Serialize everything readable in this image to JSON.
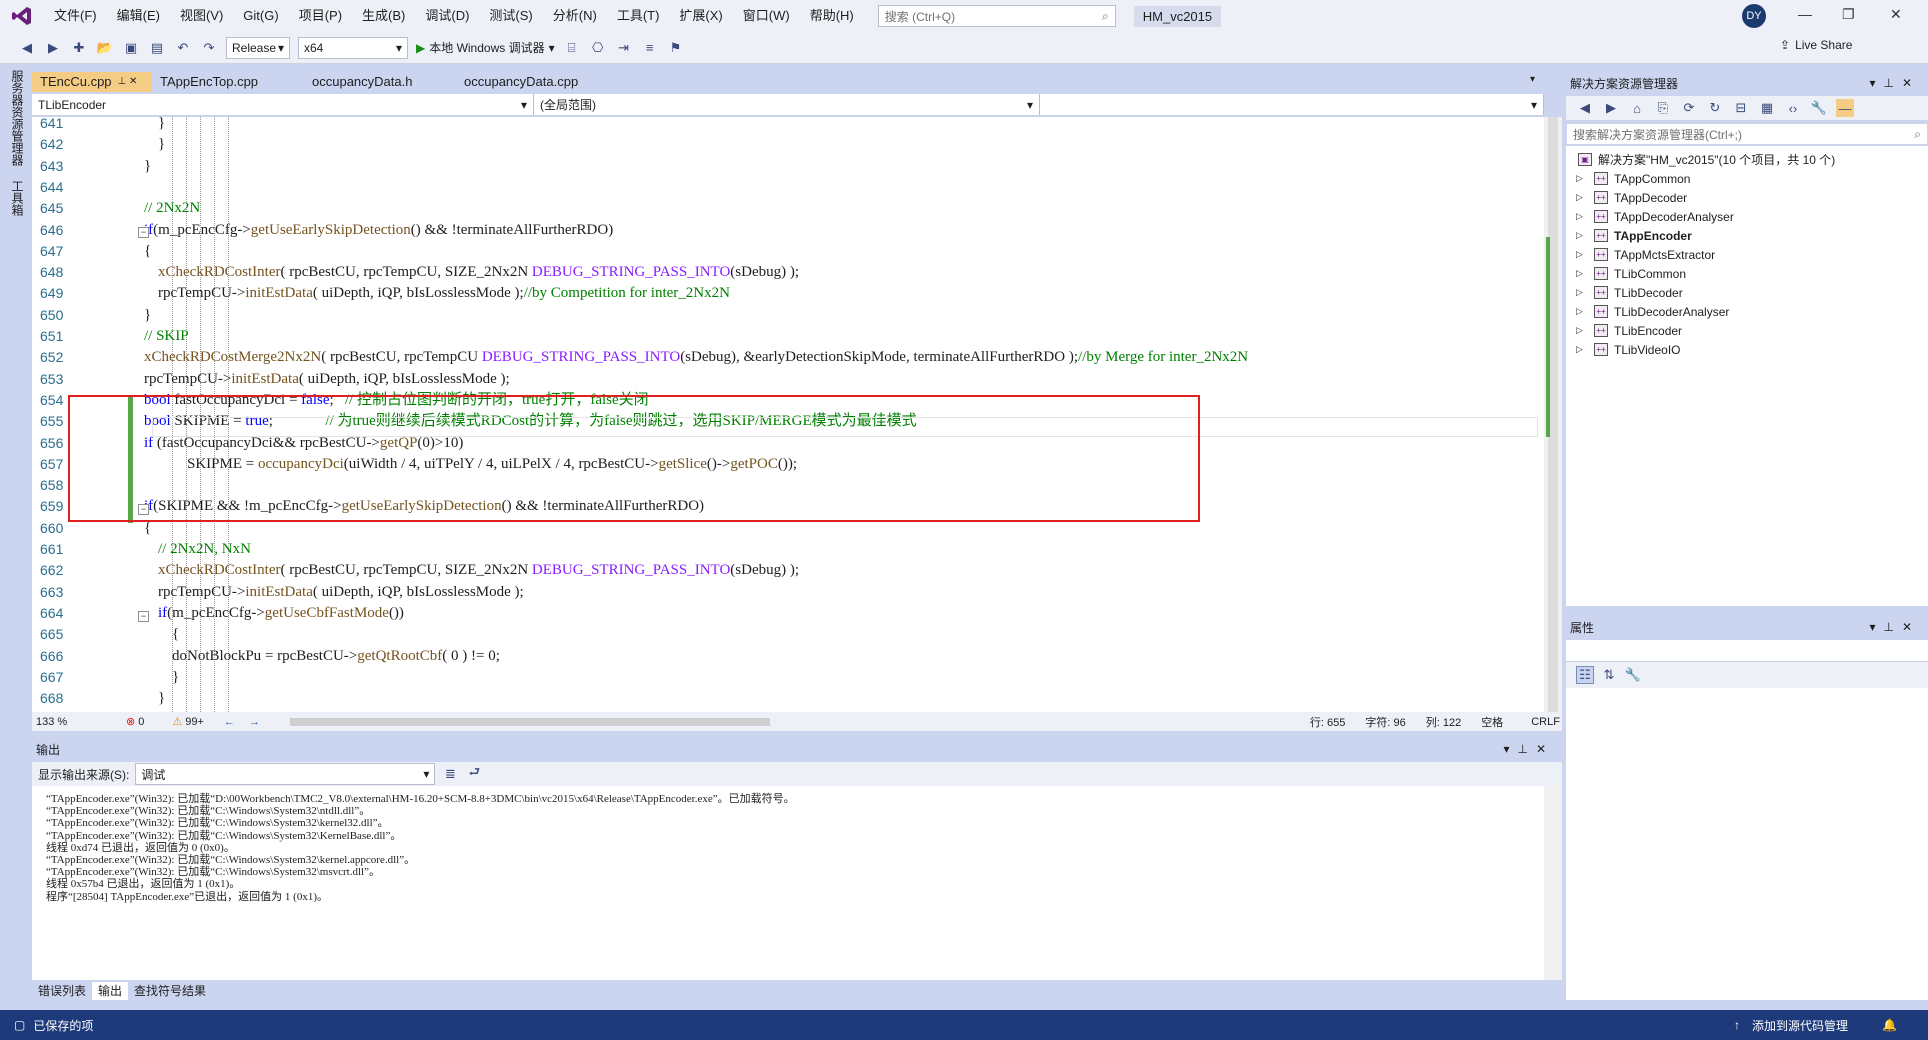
{
  "app": {
    "menu": [
      "文件(F)",
      "编辑(E)",
      "视图(V)",
      "Git(G)",
      "项目(P)",
      "生成(B)",
      "调试(D)",
      "测试(S)",
      "分析(N)",
      "工具(T)",
      "扩展(X)",
      "窗口(W)",
      "帮助(H)"
    ],
    "search_placeholder": "搜索 (Ctrl+Q)",
    "solution_name": "HM_vc2015",
    "user_initials": "DY",
    "live_share": "Live Share"
  },
  "toolbar": {
    "config": "Release",
    "platform": "x64",
    "run_label": "本地 Windows 调试器"
  },
  "left_strip": {
    "tab1": "服务器资源管理器",
    "tab2": "工具箱"
  },
  "editor": {
    "tabs": [
      {
        "label": "TEncCu.cpp",
        "active": true
      },
      {
        "label": "TAppEncTop.cpp",
        "active": false
      },
      {
        "label": "occupancyData.h",
        "active": false
      },
      {
        "label": "occupancyData.cpp",
        "active": false
      }
    ],
    "nav_scope": "TLibEncoder",
    "nav_member": "(全局范围)",
    "lines": [
      {
        "n": "641",
        "code": "}"
      },
      {
        "n": "642",
        "code": "}"
      },
      {
        "n": "643",
        "code": "}"
      },
      {
        "n": "644",
        "code": ""
      },
      {
        "n": "645",
        "code": "// 2Nx2N"
      },
      {
        "n": "646",
        "code": "if(m_pcEncCfg->getUseEarlySkipDetection() && !terminateAllFurtherRDO)"
      },
      {
        "n": "647",
        "code": "{"
      },
      {
        "n": "648",
        "code": "xCheckRDCostInter( rpcBestCU, rpcTempCU, SIZE_2Nx2N DEBUG_STRING_PASS_INTO(sDebug) );"
      },
      {
        "n": "649",
        "code": "rpcTempCU->initEstData( uiDepth, iQP, bIsLosslessMode );//by Competition for inter_2Nx2N"
      },
      {
        "n": "650",
        "code": "}"
      },
      {
        "n": "651",
        "code": "// SKIP"
      },
      {
        "n": "652",
        "code": "xCheckRDCostMerge2Nx2N( rpcBestCU, rpcTempCU DEBUG_STRING_PASS_INTO(sDebug), &earlyDetectionSkipMode, terminateAllFurtherRDO );//by Merge for inter_2Nx2N"
      },
      {
        "n": "653",
        "code": "rpcTempCU->initEstData( uiDepth, iQP, bIsLosslessMode );"
      },
      {
        "n": "654",
        "code": "bool fastOccupancyDci = false;   // 控制占位图判断的开闭，true打开，false关闭"
      },
      {
        "n": "655",
        "code": "bool SKIPME = true;              // 为true则继续后续模式RDCost的计算，为false则跳过，选用SKIP/MERGE模式为最佳模式"
      },
      {
        "n": "656",
        "code": "if (fastOccupancyDci&& rpcBestCU->getQP(0)>10)"
      },
      {
        "n": "657",
        "code": "    SKIPME = occupancyDci(uiWidth / 4, uiTPelY / 4, uiLPelX / 4, rpcBestCU->getSlice()->getPOC());"
      },
      {
        "n": "658",
        "code": ""
      },
      {
        "n": "659",
        "code": "if(SKIPME && !m_pcEncCfg->getUseEarlySkipDetection() && !terminateAllFurtherRDO)"
      },
      {
        "n": "660",
        "code": "{"
      },
      {
        "n": "661",
        "code": "// 2Nx2N, NxN"
      },
      {
        "n": "662",
        "code": "xCheckRDCostInter( rpcBestCU, rpcTempCU, SIZE_2Nx2N DEBUG_STRING_PASS_INTO(sDebug) );"
      },
      {
        "n": "663",
        "code": "rpcTempCU->initEstData( uiDepth, iQP, bIsLosslessMode );"
      },
      {
        "n": "664",
        "code": "if(m_pcEncCfg->getUseCbfFastMode())"
      },
      {
        "n": "665",
        "code": "{"
      },
      {
        "n": "666",
        "code": "doNotBlockPu = rpcBestCU->getQtRootCbf( 0 ) != 0;"
      },
      {
        "n": "667",
        "code": "}"
      },
      {
        "n": "668",
        "code": "}"
      }
    ],
    "status": {
      "zoom": "133 %",
      "errors": "0",
      "warnings": "99+",
      "line": "行: 655",
      "char": "字符: 96",
      "col": "列: 122",
      "ws": "空格",
      "eol": "CRLF"
    }
  },
  "output": {
    "title": "输出",
    "source_label": "显示输出来源(S):",
    "source_value": "调试",
    "lines": [
      "“TAppEncoder.exe”(Win32): 已加载“D:\\00Workbench\\TMC2_V8.0\\external\\HM-16.20+SCM-8.8+3DMC\\bin\\vc2015\\x64\\Release\\TAppEncoder.exe”。已加载符号。",
      "“TAppEncoder.exe”(Win32): 已加载“C:\\Windows\\System32\\ntdll.dll”。",
      "“TAppEncoder.exe”(Win32): 已加载“C:\\Windows\\System32\\kernel32.dll”。",
      "“TAppEncoder.exe”(Win32): 已加载“C:\\Windows\\System32\\KernelBase.dll”。",
      "线程 0xd74 已退出，返回值为 0 (0x0)。",
      "“TAppEncoder.exe”(Win32): 已加载“C:\\Windows\\System32\\kernel.appcore.dll”。",
      "“TAppEncoder.exe”(Win32): 已加载“C:\\Windows\\System32\\msvcrt.dll”。",
      "线程 0x57b4 已退出，返回值为 1 (0x1)。",
      "程序“[28504] TAppEncoder.exe”已退出，返回值为 1 (0x1)。"
    ],
    "tabs": [
      "错误列表",
      "输出",
      "查找符号结果"
    ]
  },
  "statusbar": {
    "left": "已保存的项",
    "right": "添加到源代码管理"
  },
  "solution_explorer": {
    "title": "解决方案资源管理器",
    "search_placeholder": "搜索解决方案资源管理器(Ctrl+;)",
    "root": "解决方案\"HM_vc2015\"(10 个项目，共 10 个)",
    "projects": [
      "TAppCommon",
      "TAppDecoder",
      "TAppDecoderAnalyser",
      "TAppEncoder",
      "TAppMctsExtractor",
      "TLibCommon",
      "TLibDecoder",
      "TLibDecoderAnalyser",
      "TLibEncoder",
      "TLibVideoIO"
    ],
    "bold_project": "TAppEncoder"
  },
  "properties": {
    "title": "属性"
  }
}
